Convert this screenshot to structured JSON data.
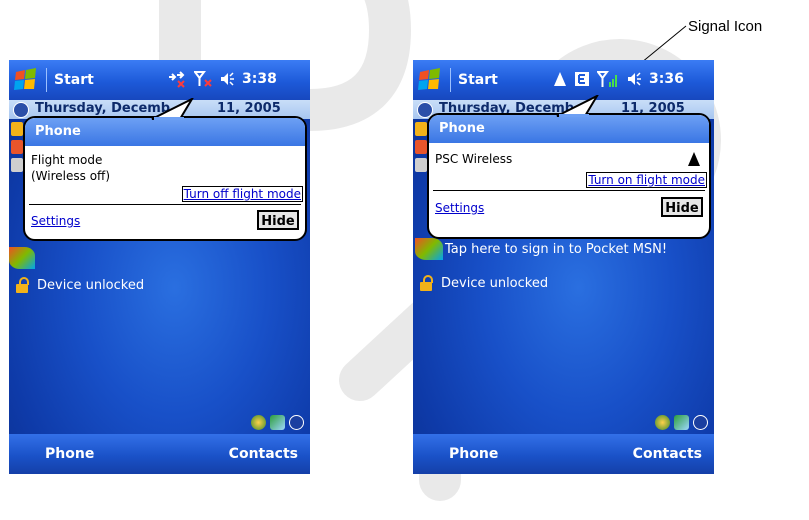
{
  "left_screen": {
    "start": "Start",
    "time": "3:38",
    "date_visible": "Thursday, Decemb",
    "date_tail": "11, 2005",
    "phone_title": "Phone",
    "status_line1": "Flight mode",
    "status_line2": "(Wireless off)",
    "toggle_link": "Turn off flight mode",
    "settings": "Settings",
    "hide": "Hide",
    "msn_fragment": "",
    "device_unlocked": "Device unlocked",
    "softkey_left": "Phone",
    "softkey_right": "Contacts"
  },
  "right_screen": {
    "start": "Start",
    "time": "3:36",
    "date_visible": "Thursday, Decemb",
    "date_tail": "11, 2005",
    "phone_title": "Phone",
    "network": "PSC Wireless",
    "toggle_link": "Turn on flight mode",
    "settings": "Settings",
    "hide": "Hide",
    "msn": "Tap here to sign in to Pocket MSN!",
    "device_unlocked": "Device unlocked",
    "softkey_left": "Phone",
    "softkey_right": "Contacts"
  },
  "annotation": {
    "signal_icon": "Signal Icon"
  },
  "colors": {
    "accent_blue": "#1d5ad9",
    "link_blue": "#0000cc",
    "bubble_header": "#3a76e4"
  },
  "icons": [
    "windows-logo-icon",
    "connectivity-icon",
    "signal-icon",
    "volume-icon",
    "clock-icon",
    "lock-icon",
    "bluetooth-icon"
  ]
}
